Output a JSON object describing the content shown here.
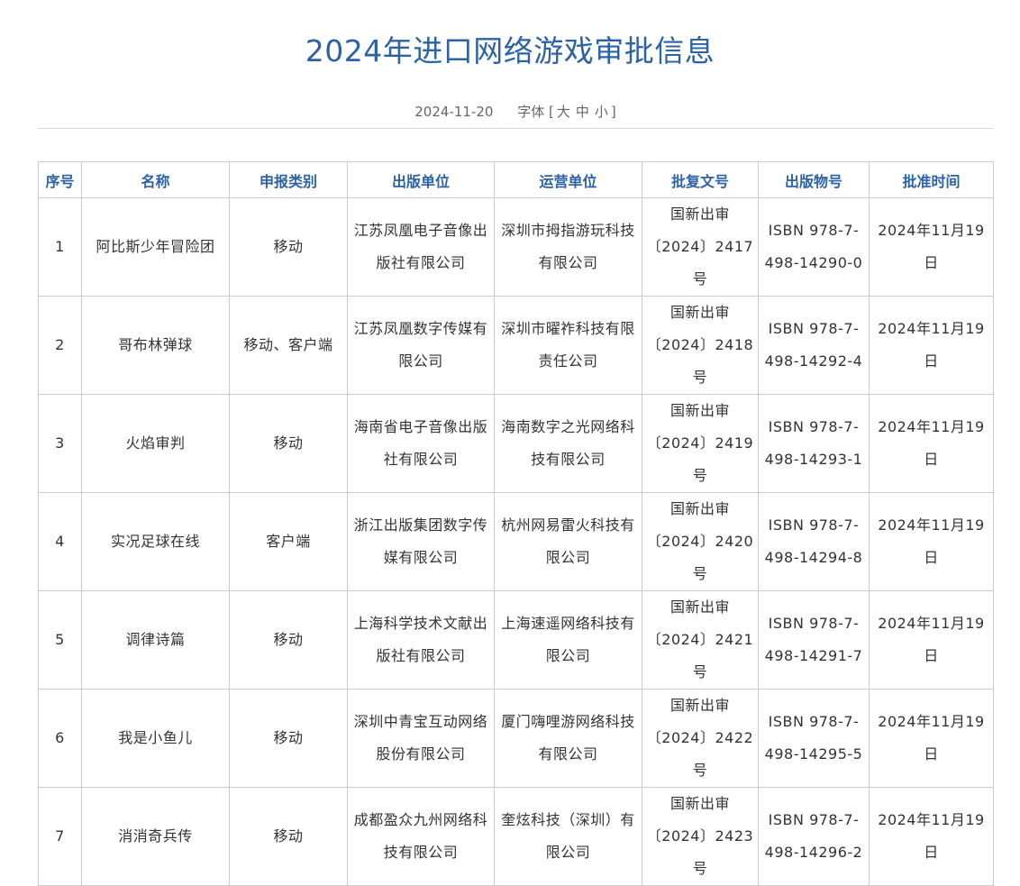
{
  "page": {
    "title": "2024年进口网络游戏审批信息",
    "date": "2024-11-20",
    "font_label": "字体",
    "font_open": "[",
    "font_large": "大",
    "font_medium": "中",
    "font_small": "小",
    "font_close": "]"
  },
  "table": {
    "headers": [
      "序号",
      "名称",
      "申报类别",
      "出版单位",
      "运营单位",
      "批复文号",
      "出版物号",
      "批准时间"
    ],
    "rows": [
      {
        "no": "1",
        "name": "阿比斯少年冒险团",
        "category": "移动",
        "publisher": "江苏凤凰电子音像出版社有限公司",
        "operator": "深圳市拇指游玩科技有限公司",
        "approval_no": "国新出审〔2024〕2417号",
        "isbn": "ISBN 978-7-498-14290-0",
        "date": "2024年11月19日"
      },
      {
        "no": "2",
        "name": "哥布林弹球",
        "category": "移动、客户端",
        "publisher": "江苏凤凰数字传媒有限公司",
        "operator": "深圳市曜祚科技有限责任公司",
        "approval_no": "国新出审〔2024〕2418号",
        "isbn": "ISBN 978-7-498-14292-4",
        "date": "2024年11月19日"
      },
      {
        "no": "3",
        "name": "火焰审判",
        "category": "移动",
        "publisher": "海南省电子音像出版社有限公司",
        "operator": "海南数字之光网络科技有限公司",
        "approval_no": "国新出审〔2024〕2419号",
        "isbn": "ISBN 978-7-498-14293-1",
        "date": "2024年11月19日"
      },
      {
        "no": "4",
        "name": "实况足球在线",
        "category": "客户端",
        "publisher": "浙江出版集团数字传媒有限公司",
        "operator": "杭州网易雷火科技有限公司",
        "approval_no": "国新出审〔2024〕2420号",
        "isbn": "ISBN 978-7-498-14294-8",
        "date": "2024年11月19日"
      },
      {
        "no": "5",
        "name": "调律诗篇",
        "category": "移动",
        "publisher": "上海科学技术文献出版社有限公司",
        "operator": "上海速遥网络科技有限公司",
        "approval_no": "国新出审〔2024〕2421号",
        "isbn": "ISBN 978-7-498-14291-7",
        "date": "2024年11月19日"
      },
      {
        "no": "6",
        "name": "我是小鱼儿",
        "category": "移动",
        "publisher": "深圳中青宝互动网络股份有限公司",
        "operator": "厦门嗨哩游网络科技有限公司",
        "approval_no": "国新出审〔2024〕2422号",
        "isbn": "ISBN 978-7-498-14295-5",
        "date": "2024年11月19日"
      },
      {
        "no": "7",
        "name": "消消奇兵传",
        "category": "移动",
        "publisher": "成都盈众九州网络科技有限公司",
        "operator": "奎炫科技（深圳）有限公司",
        "approval_no": "国新出审〔2024〕2423号",
        "isbn": "ISBN 978-7-498-14296-2",
        "date": "2024年11月19日"
      }
    ]
  }
}
